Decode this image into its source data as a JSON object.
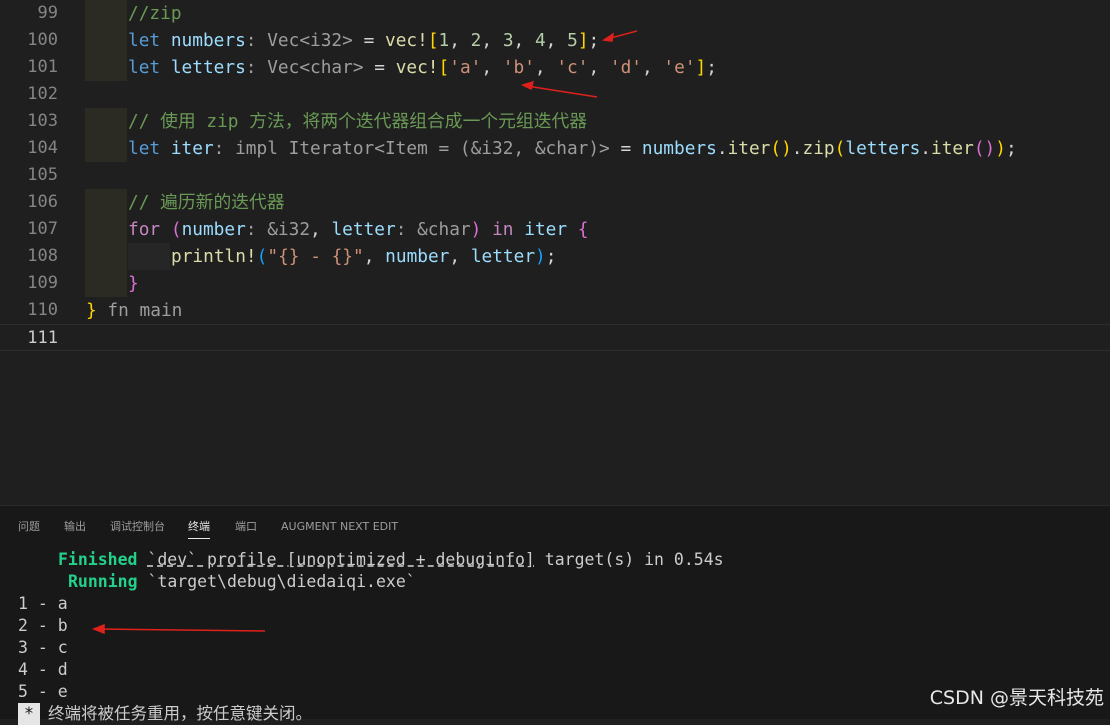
{
  "editor": {
    "line_numbers": [
      "99",
      "100",
      "101",
      "102",
      "103",
      "104",
      "105",
      "106",
      "107",
      "108",
      "109",
      "110",
      "111"
    ],
    "l99": {
      "comment": "//zip"
    },
    "l100": {
      "let": "let",
      "name": "numbers",
      "colon": ":",
      "type": " Vec<i32>",
      "eq": " = ",
      "macro": "vec!",
      "open": "[",
      "n1": "1",
      "n2": "2",
      "n3": "3",
      "n4": "4",
      "n5": "5",
      "close": "]",
      "semi": ";"
    },
    "l101": {
      "let": "let",
      "name": "letters",
      "colon": ":",
      "type": " Vec<char>",
      "eq": " = ",
      "macro": "vec!",
      "open": "[",
      "s1": "'a'",
      "s2": "'b'",
      "s3": "'c'",
      "s4": "'d'",
      "s5": "'e'",
      "close": "]",
      "semi": ";"
    },
    "l103": {
      "comment": "// 使用 zip 方法，将两个迭代器组合成一个元组迭代器"
    },
    "l104": {
      "let": "let",
      "name": "iter",
      "hint": ": impl Iterator<Item = (&i32, &char)>",
      "eq": " = ",
      "recv": "numbers",
      "m1": "iter",
      "m2": "zip",
      "arg": "letters",
      "m3": "iter",
      "semi": ";"
    },
    "l106": {
      "comment": "// 遍历新的迭代器"
    },
    "l107": {
      "for": "for",
      "open": "(",
      "v1": "number",
      "h1": ": &i32",
      "comma": ", ",
      "v2": "letter",
      "h2": ": &char",
      "close": ")",
      "in": "in",
      "iter": "iter",
      "brace": "{"
    },
    "l108": {
      "macro": "println!",
      "open": "(",
      "fmt": "\"{} - {}\"",
      "v1": "number",
      "v2": "letter",
      "close": ")",
      "semi": ";"
    },
    "l109": {
      "brace": "}"
    },
    "l110": {
      "brace": "}",
      "hint": " fn main"
    }
  },
  "panel": {
    "tabs": [
      "问题",
      "输出",
      "调试控制台",
      "终端",
      "端口",
      "AUGMENT NEXT EDIT"
    ],
    "active_tab": "终端"
  },
  "terminal": {
    "finished_label": "Finished",
    "finished_profile": "`dev` profile [unoptimized + debuginfo]",
    "finished_rest": " target(s) in 0.54s",
    "running_label": "Running",
    "running_path": "`target\\debug\\diedaiqi.exe`",
    "output": [
      "1 - a",
      "2 - b",
      "3 - c",
      "4 - d",
      "5 - e"
    ],
    "footer_marker": "*",
    "footer_text": "终端将被任务重用，按任意键关闭。"
  },
  "watermark": "CSDN @景天科技苑",
  "colors": {
    "annotation_arrow": "#e0201b",
    "terminal_green": "#23d18b"
  }
}
